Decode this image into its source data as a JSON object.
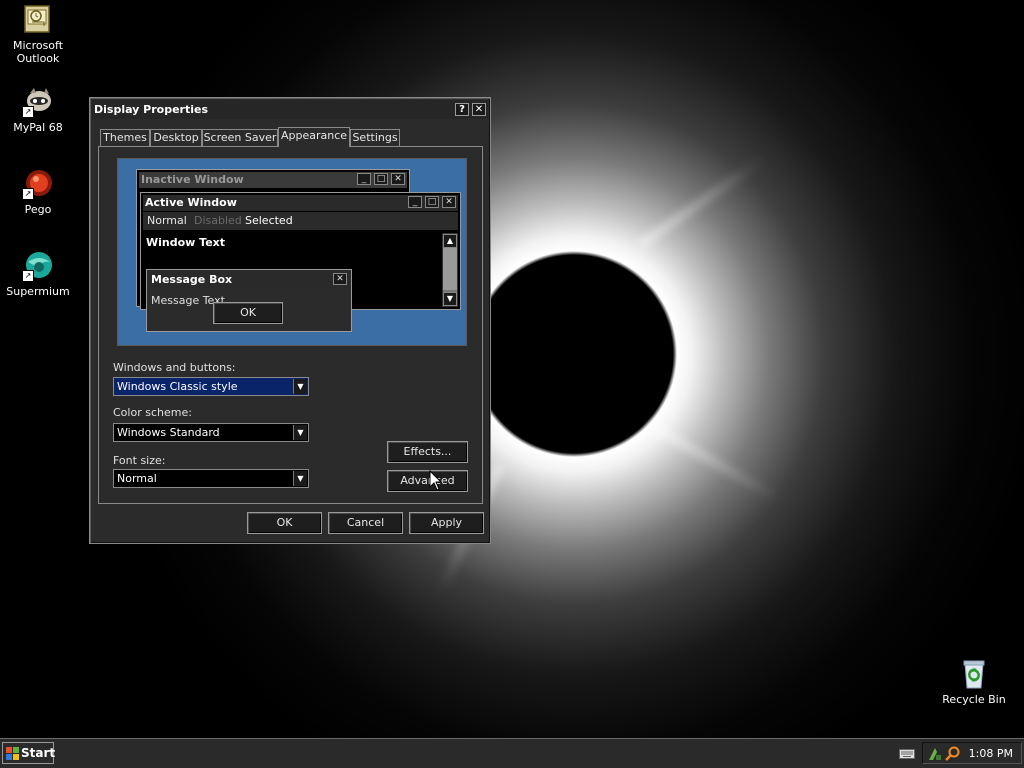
{
  "desktop": {
    "icons": [
      {
        "label_line1": "Microsoft",
        "label_line2": "Outlook"
      },
      {
        "label_line1": "MyPal 68",
        "label_line2": ""
      },
      {
        "label_line1": "Pego",
        "label_line2": ""
      },
      {
        "label_line1": "Supermium",
        "label_line2": ""
      },
      {
        "label_line1": "Recycle Bin",
        "label_line2": ""
      }
    ]
  },
  "dialog": {
    "title": "Display Properties",
    "help_glyph": "?",
    "close_glyph": "✕",
    "tabs": [
      "Themes",
      "Desktop",
      "Screen Saver",
      "Appearance",
      "Settings"
    ],
    "active_tab": "Appearance",
    "preview": {
      "inactive_title": "Inactive Window",
      "active_title": "Active Window",
      "menu_normal": "Normal",
      "menu_disabled": "Disabled",
      "menu_selected": "Selected",
      "window_text": "Window Text",
      "msgbox_title": "Message Box",
      "msgbox_text": "Message Text",
      "msgbox_ok": "OK"
    },
    "windows_buttons_label": "Windows and buttons:",
    "windows_buttons_value": "Windows Classic style",
    "color_scheme_label": "Color scheme:",
    "color_scheme_value": "Windows Standard",
    "font_size_label": "Font size:",
    "font_size_value": "Normal",
    "effects_button": "Effects...",
    "advanced_button": "Advanced",
    "ok_button": "OK",
    "cancel_button": "Cancel",
    "apply_button": "Apply"
  },
  "taskbar": {
    "start_label": "Start",
    "clock": "1:08 PM"
  },
  "colors": {
    "preview_desktop": "#3a6ea5",
    "selection": "#0a246a",
    "dialog_bg": "#2b2b2b"
  }
}
